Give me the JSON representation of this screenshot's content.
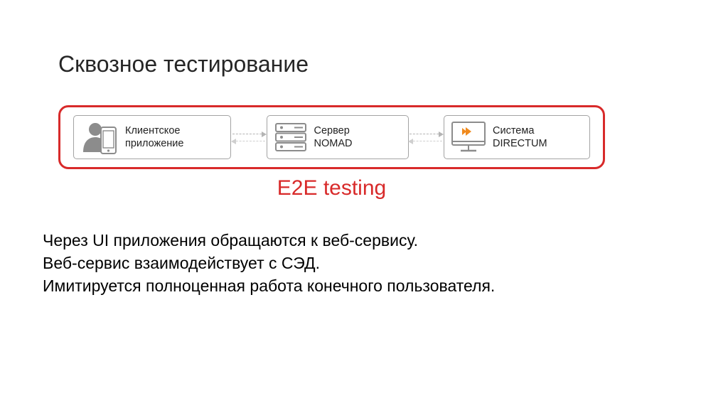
{
  "title": "Сквозное тестирование",
  "e2e_label": "E2E testing",
  "nodes": {
    "client": {
      "line1": "Клиентское",
      "line2": "приложение"
    },
    "server": {
      "line1": "Сервер",
      "line2": "NOMAD"
    },
    "system": {
      "line1": "Система",
      "line2": "DIRECTUM"
    }
  },
  "body": {
    "line1": "Через UI приложения обращаются к веб-сервису.",
    "line2": "Веб-сервис взаимодействует с СЭД.",
    "line3": "Имитируется полноценная работа конечного пользователя."
  },
  "colors": {
    "accent_red": "#d82a2a",
    "icon_gray": "#8c8c8c",
    "directum_orange": "#f08a1d"
  }
}
